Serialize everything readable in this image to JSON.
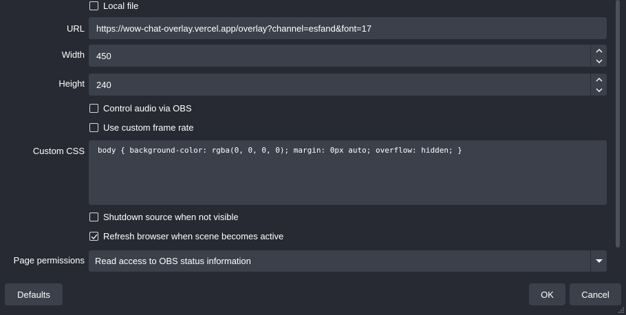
{
  "form": {
    "local_file": {
      "label": "Local file",
      "checked": false
    },
    "url": {
      "label": "URL",
      "value": "https://wow-chat-overlay.vercel.app/overlay?channel=esfand&font=17"
    },
    "width": {
      "label": "Width",
      "value": "450"
    },
    "height": {
      "label": "Height",
      "value": "240"
    },
    "control_audio": {
      "label": "Control audio via OBS",
      "checked": false
    },
    "custom_frame_rate": {
      "label": "Use custom frame rate",
      "checked": false
    },
    "custom_css": {
      "label": "Custom CSS",
      "value": "body { background-color: rgba(0, 0, 0, 0); margin: 0px auto; overflow: hidden; }"
    },
    "shutdown_source": {
      "label": "Shutdown source when not visible",
      "checked": false
    },
    "refresh_browser": {
      "label": "Refresh browser when scene becomes active",
      "checked": true
    },
    "page_permissions": {
      "label": "Page permissions",
      "value": "Read access to OBS status information"
    }
  },
  "footer": {
    "defaults_label": "Defaults",
    "ok_label": "OK",
    "cancel_label": "Cancel"
  },
  "colors": {
    "background": "#272a33",
    "field": "#3c404b",
    "text": "#ffffff"
  }
}
